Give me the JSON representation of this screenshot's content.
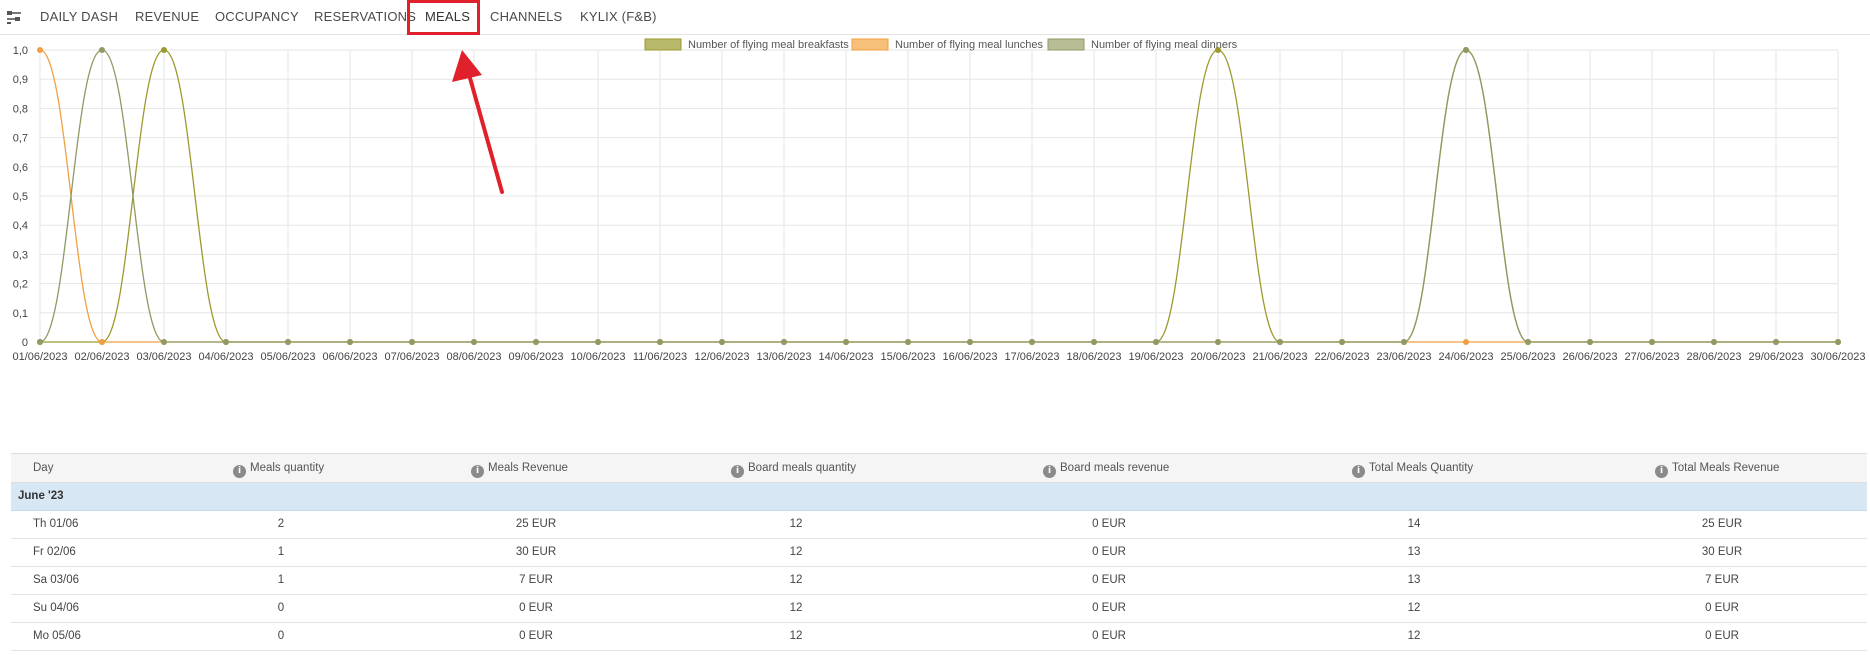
{
  "nav": {
    "tabs": [
      {
        "label": "DAILY DASH"
      },
      {
        "label": "REVENUE"
      },
      {
        "label": "OCCUPANCY"
      },
      {
        "label": "RESERVATIONS"
      },
      {
        "label": "MEALS",
        "active": true
      },
      {
        "label": "CHANNELS"
      },
      {
        "label": "KYLIX (F&B)"
      }
    ],
    "icon": "settings-sliders-icon"
  },
  "annotation": {
    "color": "#e0202a",
    "arrow": "arrow-pointing-to-meals-tab"
  },
  "chart_data": {
    "type": "line",
    "title": "",
    "xlabel": "",
    "ylabel": "",
    "ylim": [
      0,
      1.0
    ],
    "yticks": [
      "0",
      "0,1",
      "0,2",
      "0,3",
      "0,4",
      "0,5",
      "0,6",
      "0,7",
      "0,8",
      "0,9",
      "1,0"
    ],
    "grid": true,
    "legend": "top-center",
    "x": [
      "01/06/2023",
      "02/06/2023",
      "03/06/2023",
      "04/06/2023",
      "05/06/2023",
      "06/06/2023",
      "07/06/2023",
      "08/06/2023",
      "09/06/2023",
      "10/06/2023",
      "11/06/2023",
      "12/06/2023",
      "13/06/2023",
      "14/06/2023",
      "15/06/2023",
      "16/06/2023",
      "17/06/2023",
      "18/06/2023",
      "19/06/2023",
      "20/06/2023",
      "21/06/2023",
      "22/06/2023",
      "23/06/2023",
      "24/06/2023",
      "25/06/2023",
      "26/06/2023",
      "27/06/2023",
      "28/06/2023",
      "29/06/2023",
      "30/06/2023"
    ],
    "series": [
      {
        "name": "Number of flying meal breakfasts",
        "color": "#9c9a2e",
        "fill": "#b8b86a",
        "values": [
          0,
          0,
          1,
          0,
          0,
          0,
          0,
          0,
          0,
          0,
          0,
          0,
          0,
          0,
          0,
          0,
          0,
          0,
          0,
          1,
          0,
          0,
          0,
          1,
          0,
          0,
          0,
          0,
          0,
          0
        ]
      },
      {
        "name": "Number of flying meal lunches",
        "color": "#f0a040",
        "fill": "#f7c07a",
        "values": [
          1,
          0,
          0,
          0,
          0,
          0,
          0,
          0,
          0,
          0,
          0,
          0,
          0,
          0,
          0,
          0,
          0,
          0,
          0,
          0,
          0,
          0,
          0,
          0,
          0,
          0,
          0,
          0,
          0,
          0
        ]
      },
      {
        "name": "Number of flying meal dinners",
        "color": "#8f9a66",
        "fill": "#b9bd96",
        "values": [
          0,
          1,
          0,
          0,
          0,
          0,
          0,
          0,
          0,
          0,
          0,
          0,
          0,
          0,
          0,
          0,
          0,
          0,
          0,
          0,
          0,
          0,
          0,
          1,
          0,
          0,
          0,
          0,
          0,
          0
        ]
      }
    ]
  },
  "table": {
    "headers": [
      {
        "label": "Day",
        "info": false
      },
      {
        "label": "Meals quantity",
        "info": true
      },
      {
        "label": "Meals Revenue",
        "info": true
      },
      {
        "label": "Board meals quantity",
        "info": true
      },
      {
        "label": "Board meals revenue",
        "info": true
      },
      {
        "label": "Total Meals Quantity",
        "info": true
      },
      {
        "label": "Total Meals Revenue",
        "info": true
      }
    ],
    "group": "June '23",
    "rows": [
      {
        "day": "Th 01/06",
        "meals_qty": "2",
        "meals_rev": "25 EUR",
        "board_qty": "12",
        "board_rev": "0 EUR",
        "total_qty": "14",
        "total_rev": "25 EUR"
      },
      {
        "day": "Fr 02/06",
        "meals_qty": "1",
        "meals_rev": "30 EUR",
        "board_qty": "12",
        "board_rev": "0 EUR",
        "total_qty": "13",
        "total_rev": "30 EUR"
      },
      {
        "day": "Sa 03/06",
        "meals_qty": "1",
        "meals_rev": "7 EUR",
        "board_qty": "12",
        "board_rev": "0 EUR",
        "total_qty": "13",
        "total_rev": "7 EUR"
      },
      {
        "day": "Su 04/06",
        "meals_qty": "0",
        "meals_rev": "0 EUR",
        "board_qty": "12",
        "board_rev": "0 EUR",
        "total_qty": "12",
        "total_rev": "0 EUR"
      },
      {
        "day": "Mo 05/06",
        "meals_qty": "0",
        "meals_rev": "0 EUR",
        "board_qty": "12",
        "board_rev": "0 EUR",
        "total_qty": "12",
        "total_rev": "0 EUR"
      }
    ]
  }
}
